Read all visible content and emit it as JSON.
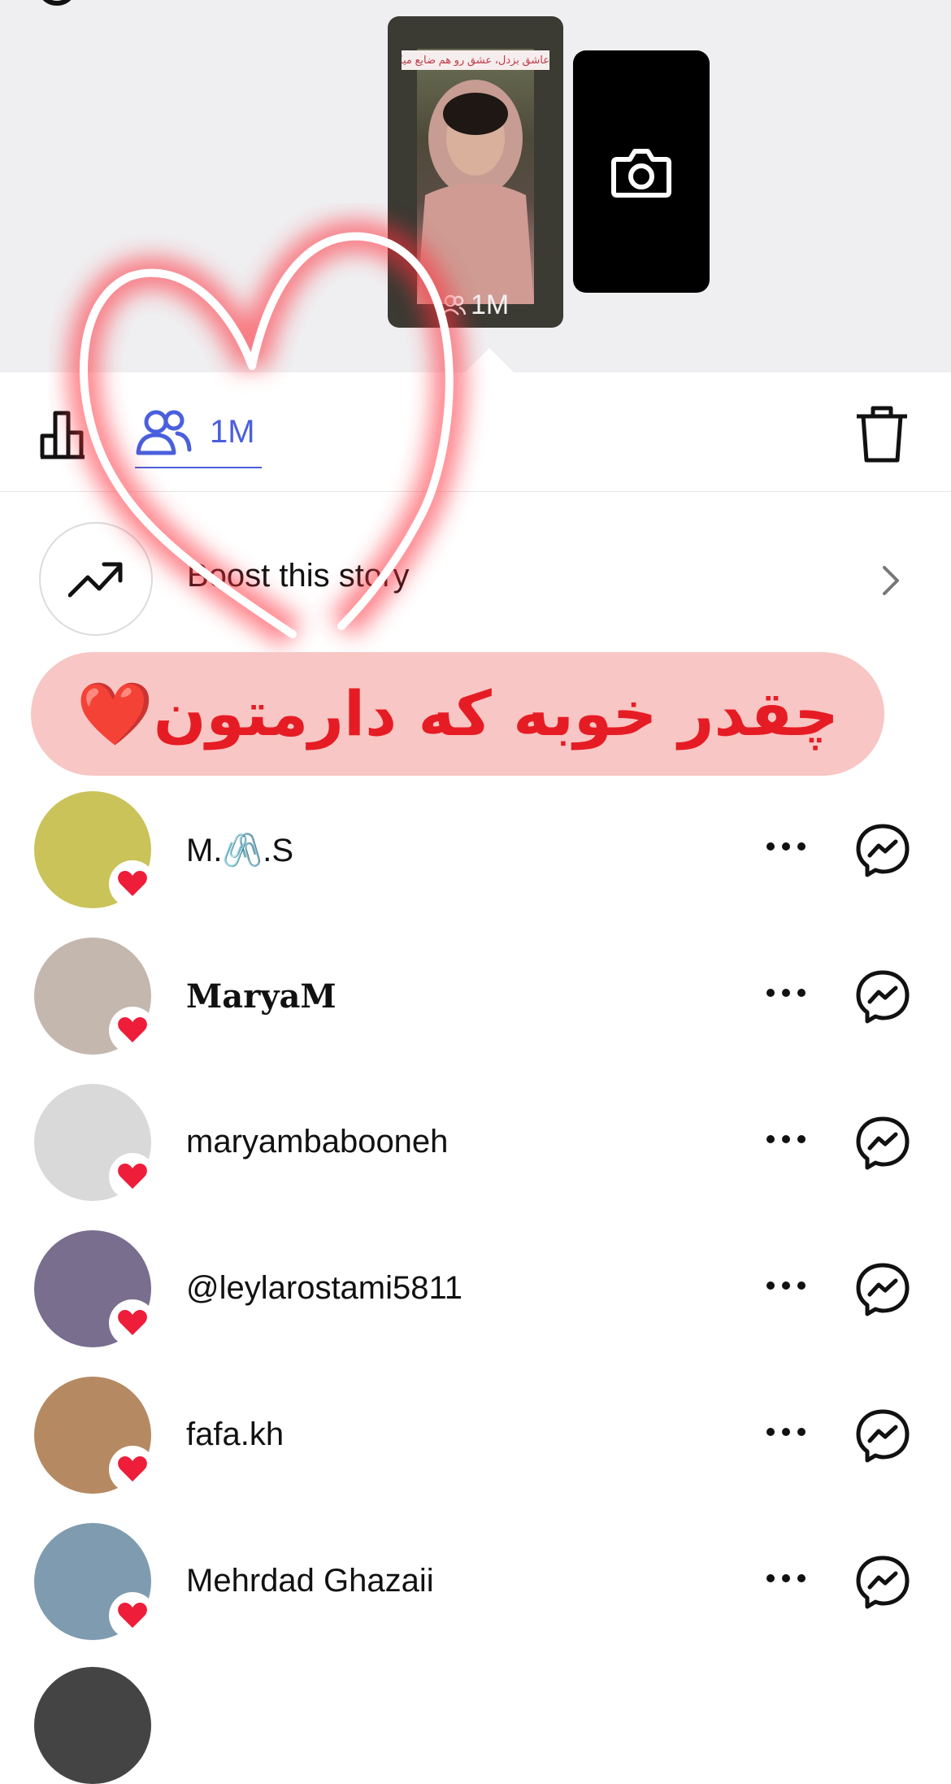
{
  "story": {
    "caption": "عاشق بزدل، عشق رو هم ضایع میکنه",
    "views_label": "1M"
  },
  "toolbar": {
    "viewers_count": "1M"
  },
  "boost": {
    "label": "Boost this story"
  },
  "banner": {
    "text": "چقدر خوبه که دارمتون❤️"
  },
  "viewers": [
    {
      "name": "M.🖇️.S",
      "avatar_color": "#c9c35a"
    },
    {
      "name": "MaryaM",
      "avatar_color": "#c4b7ad"
    },
    {
      "name": "maryambabooneh",
      "avatar_color": "#d9d9d9"
    },
    {
      "name": "@leylarostami5811",
      "avatar_color": "#7a6e8f"
    },
    {
      "name": "fafa.kh",
      "avatar_color": "#b58a62"
    },
    {
      "name": "Mehrdad Ghazaii",
      "avatar_color": "#7f9bb0"
    }
  ],
  "colors": {
    "accent": "#4a5fdd",
    "like": "#ee1d3a",
    "banner_bg": "#f8c6c4",
    "banner_text": "#e61c24"
  }
}
